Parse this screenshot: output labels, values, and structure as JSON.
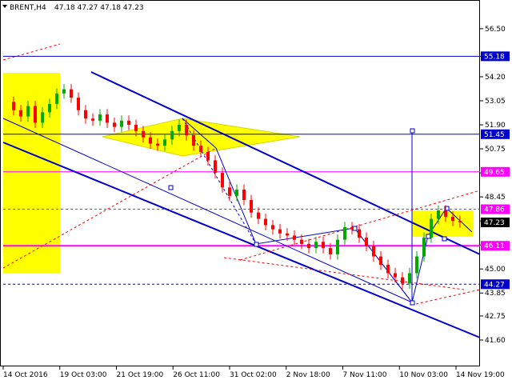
{
  "header": {
    "symbol": "BRENT,H4",
    "ohlc": "47.18 47.27 47.18 47.23"
  },
  "chart_data": {
    "type": "candlestick",
    "symbol": "BRENT",
    "timeframe": "H4",
    "ylim": [
      41.6,
      57.3
    ],
    "y_ticks": [
      56.5,
      55.18,
      54.2,
      53.05,
      51.9,
      50.75,
      49.6,
      48.45,
      47.3,
      46.15,
      45.0,
      43.85,
      42.75,
      41.6
    ],
    "x_labels": [
      "14 Oct 2016",
      "19 Oct 03:00",
      "21 Oct 19:00",
      "26 Oct 11:00",
      "31 Oct 02:00",
      "2 Nov 18:00",
      "7 Nov 11:00",
      "10 Nov 03:00",
      "14 Nov 19:00"
    ],
    "price_tags": [
      {
        "label": "55.18",
        "value": 55.18,
        "color": "#0000cc"
      },
      {
        "label": "51.45",
        "value": 51.45,
        "color": "#0000cc"
      },
      {
        "label": "49.65",
        "value": 49.65,
        "color": "#ff00ff"
      },
      {
        "label": "47.86",
        "value": 47.86,
        "color": "#ff00ff"
      },
      {
        "label": "47.23",
        "value": 47.23,
        "color": "#000000"
      },
      {
        "label": "46.11",
        "value": 46.11,
        "color": "#ff00ff"
      },
      {
        "label": "44.27",
        "value": 44.27,
        "color": "#0000cc"
      }
    ],
    "close_series": [
      53.0,
      52.6,
      52.3,
      52.8,
      52.0,
      52.5,
      52.9,
      53.4,
      53.6,
      53.2,
      52.6,
      52.2,
      52.1,
      52.4,
      52.0,
      51.8,
      52.1,
      51.9,
      51.6,
      51.3,
      51.0,
      50.9,
      51.2,
      51.6,
      51.9,
      51.4,
      50.9,
      50.6,
      50.2,
      49.6,
      48.9,
      48.5,
      48.8,
      48.3,
      47.7,
      47.4,
      47.1,
      46.9,
      46.7,
      46.6,
      46.4,
      46.2,
      46.0,
      46.3,
      46.0,
      45.7,
      46.4,
      47.0,
      46.9,
      46.5,
      46.1,
      45.6,
      45.2,
      44.8,
      44.6,
      44.3,
      44.8,
      45.6,
      46.5,
      47.4,
      47.8,
      47.5,
      47.3,
      47.23
    ],
    "colors": {
      "up": "#00aa00",
      "down": "#ff0000",
      "channel": "#0000cc",
      "level": "#ff00ff",
      "highlight": "#ffff00"
    },
    "grid": false
  }
}
